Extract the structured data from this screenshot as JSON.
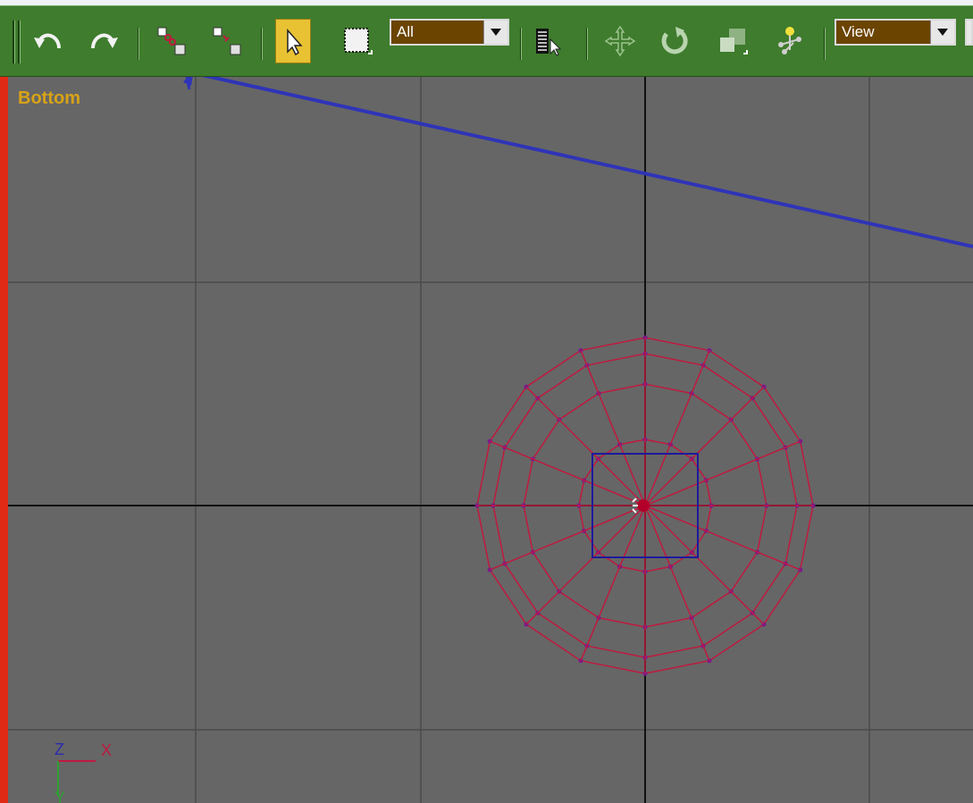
{
  "toolbar": {
    "undo": "undo-icon",
    "redo": "redo-icon",
    "select_link": "select-and-link-icon",
    "unlink": "unlink-selection-icon",
    "select_object": "select-object-icon",
    "select_region": "rectangular-selection-region-icon",
    "selection_filter": {
      "value": "All"
    },
    "select_by_name": "select-by-name-icon",
    "move": "select-and-move-icon",
    "rotate": "select-and-rotate-icon",
    "scale": "select-and-scale-icon",
    "pivot": "use-pivot-center-icon",
    "reference_coord": {
      "value": "View"
    },
    "active_button": "select_object",
    "colors": {
      "bar": "#3f7c2e",
      "active": "#e8c233",
      "dropdown": "#6b4400"
    }
  },
  "viewport": {
    "label": "Bottom",
    "border_color": "#e12a15",
    "background": "#666666",
    "axis_tripod": {
      "axis1": "Z",
      "axis2": "X",
      "axis3": "Y"
    },
    "mesh_color": "#c0193f",
    "gizmo_color": "#1e1a9a"
  }
}
